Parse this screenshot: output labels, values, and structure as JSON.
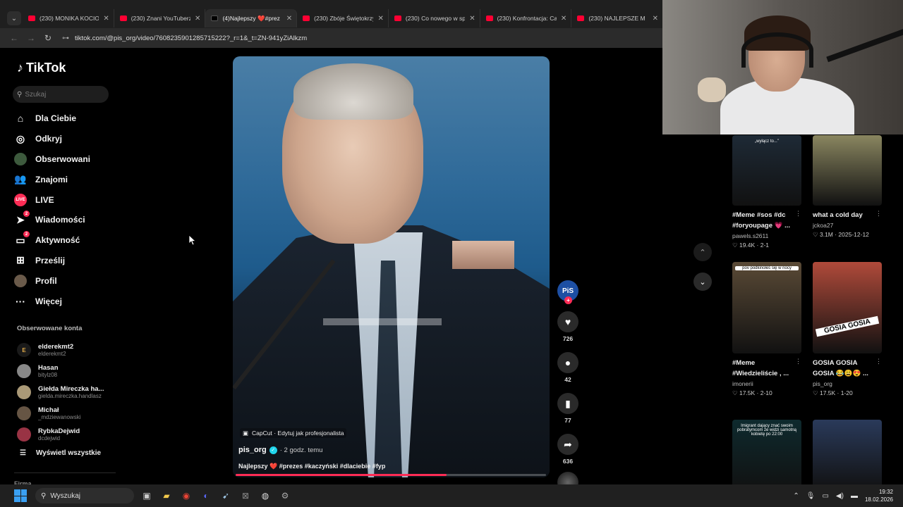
{
  "browser": {
    "tabs": [
      {
        "title": "(230) MONIKA KOCIOŁEK",
        "favicon": "youtube-icon",
        "active": false
      },
      {
        "title": "(230) Znani YouTuberzy a",
        "favicon": "youtube-icon",
        "active": false
      },
      {
        "title": "(4)Najlepszy ❤️#prez",
        "favicon": "tiktok-icon",
        "active": true
      },
      {
        "title": "(230) Zbóje Świętokrzysc",
        "favicon": "youtube-icon",
        "active": false
      },
      {
        "title": "(230) Co nowego w sprze",
        "favicon": "youtube-icon",
        "active": false
      },
      {
        "title": "(230) Konfrontacja: Came",
        "favicon": "youtube-icon",
        "active": false
      },
      {
        "title": "(230) NAJLEPSZE M",
        "favicon": "youtube-icon",
        "active": false
      }
    ],
    "url": "tiktok.com/@pis_org/video/7608235901285715222?_r=1&_t=ZN-941yZiAlkzm"
  },
  "tiktok": {
    "logo": "TikTok",
    "search_placeholder": "Szukaj",
    "menu": [
      {
        "label": "Dla Ciebie",
        "icon": "home-icon",
        "glyph": "⌂"
      },
      {
        "label": "Odkryj",
        "icon": "compass-icon",
        "glyph": "◎"
      },
      {
        "label": "Obserwowani",
        "icon": "following-avatar-icon",
        "glyph": ""
      },
      {
        "label": "Znajomi",
        "icon": "friends-icon",
        "glyph": "👥"
      },
      {
        "label": "LIVE",
        "icon": "live-icon",
        "glyph": "LIVE"
      },
      {
        "label": "Wiadomości",
        "icon": "messages-icon",
        "glyph": "➤",
        "badge": "2"
      },
      {
        "label": "Aktywność",
        "icon": "activity-icon",
        "glyph": "▭",
        "badge": "2"
      },
      {
        "label": "Prześlij",
        "icon": "upload-icon",
        "glyph": "⊞"
      },
      {
        "label": "Profil",
        "icon": "profile-avatar-icon",
        "glyph": ""
      },
      {
        "label": "Więcej",
        "icon": "more-icon",
        "glyph": "···"
      }
    ],
    "following_title": "Obserwowane konta",
    "following": [
      {
        "name": "elderekmt2",
        "handle": "elderekmt2",
        "color": "#1a1a1a",
        "initial": "E"
      },
      {
        "name": "Hasan",
        "handle": "bitylz08",
        "color": "#888888",
        "initial": ""
      },
      {
        "name": "Giełda Mireczka ha...",
        "handle": "gielda.mireczka.handlasz",
        "color": "#aa9977",
        "initial": ""
      },
      {
        "name": "Michał",
        "handle": "_mdziewanowski",
        "color": "#665544",
        "initial": ""
      },
      {
        "name": "RybkaDejwid",
        "handle": "dcdejwid",
        "color": "#993344",
        "initial": ""
      }
    ],
    "show_all": "Wyświetl wszystkie",
    "firma": "Firma",
    "video": {
      "capcut": "CapCut · Edytuj jak profesjonalista",
      "author": "pis_org",
      "time": "· 2 godz. temu",
      "caption": "Najlepszy ❤️ #prezes #kaczyński #dlaciebie #fyp",
      "progress": 0.68
    },
    "actions": {
      "avatar_text": "PiS",
      "likes": "726",
      "comments": "42",
      "saves": "77",
      "shares": "636"
    }
  },
  "recommendations": [
    {
      "title": "#Meme #sos #dc #foryoupage 💗 ...",
      "user": "pawels.s2611",
      "stats": "♡ 19.4K · 2-1",
      "thumb_text": "„wyłącz to...”",
      "thumb_bg": "#1e2a36"
    },
    {
      "title": "what a cold day",
      "user": "jckoa27",
      "stats": "♡ 3.1M · 2025-12-12",
      "thumb_text": "",
      "thumb_bg": "#8a8660"
    },
    {
      "title": "#Meme #Wiedzieliście , ...",
      "user": "imonerii",
      "stats": "♡ 17.5K · 2-10",
      "thumb_text": "pov podkinołeś się w nocy",
      "thumb_bg": "#5a4a36"
    },
    {
      "title": "GOSIA GOSIA GOSIA 😂😩😍 ...",
      "user": "pis_org",
      "stats": "♡ 17.5K · 1-20",
      "thumb_text": "GOSIA GOSIA",
      "thumb_bg": "#b04a3a"
    },
    {
      "title": "",
      "user": "",
      "stats": "",
      "thumb_text": "Imigrant dający znać swoim pobratymcom że widzi samotną kobietę po 22:00",
      "thumb_bg": "#0e2a2e"
    },
    {
      "title": "",
      "user": "",
      "stats": "",
      "thumb_text": "",
      "thumb_bg": "#2a3a5a"
    }
  ],
  "taskbar": {
    "search_placeholder": "Wyszukaj",
    "time": "19:32",
    "date": "18.02.2026"
  }
}
